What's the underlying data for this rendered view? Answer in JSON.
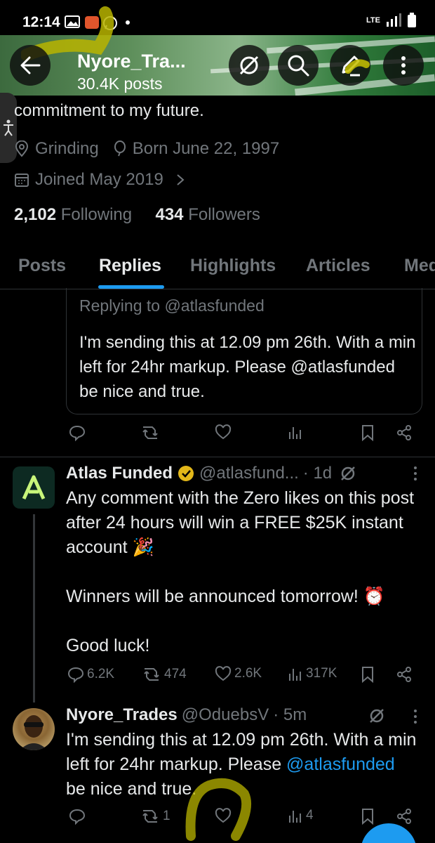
{
  "status_bar": {
    "time": "12:14",
    "network": "LTE"
  },
  "header": {
    "name": "Nyore_Tra...",
    "posts": "30.4K posts"
  },
  "profile": {
    "bio_line": "commitment to my future.",
    "location": "Grinding",
    "birthday": "Born June 22, 1997",
    "joined": "Joined May 2019",
    "following_count": "2,102",
    "following_label": "Following",
    "followers_count": "434",
    "followers_label": "Followers"
  },
  "tabs": [
    {
      "label": "Posts"
    },
    {
      "label": "Replies"
    },
    {
      "label": "Highlights"
    },
    {
      "label": "Articles"
    },
    {
      "label": "Med"
    }
  ],
  "quoted_reply": {
    "replying_to": "Replying to @atlasfunded",
    "text": "I'm sending this at 12.09 pm 26th. With a min left for 24hr markup. Please @atlasfunded be nice and true."
  },
  "tweet_atlas": {
    "name": "Atlas Funded",
    "handle": "@atlasfund...",
    "time": "· 1d",
    "line1": "Any comment with the Zero likes on this post after 24 hours will win a FREE $25K instant account 🎉",
    "line2": "Winners will be announced tomorrow! ⏰",
    "line3": "Good luck!",
    "replies": "6.2K",
    "reposts": "474",
    "likes": "2.6K",
    "views": "317K"
  },
  "tweet_user": {
    "name": "Nyore_Trades",
    "handle": "@OduebsV",
    "time": "· 5m",
    "text_a": "I'm sending this at 12.09 pm 26th. With a min left for 24hr markup. Please ",
    "mention": "@atlasfunded",
    "text_b": " be nice and true.",
    "reposts": "1",
    "views": "4"
  },
  "colors": {
    "accent": "#1d9bf0",
    "muted": "#71767b",
    "text": "#e7e9ea",
    "verified": "#e2b719"
  }
}
